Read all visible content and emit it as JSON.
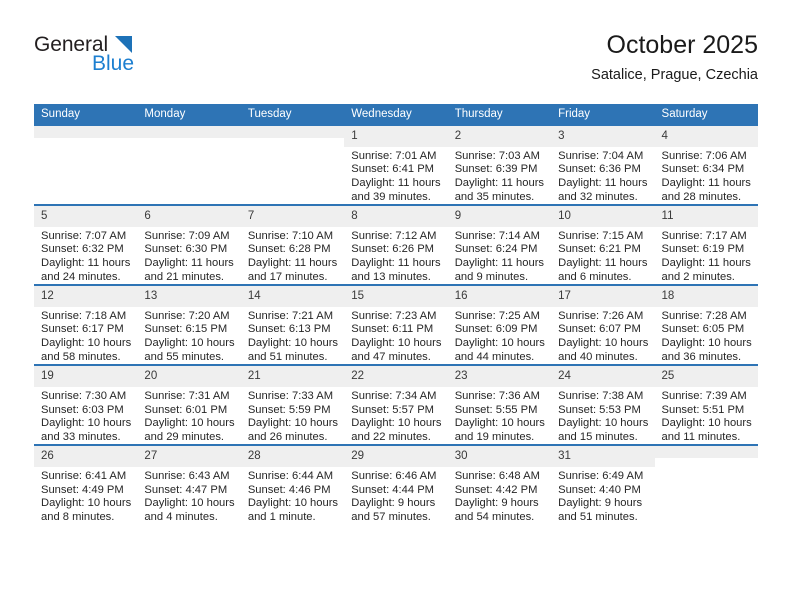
{
  "brand": {
    "name_top": "General",
    "name_bottom": "Blue",
    "triangle_color": "#1d72b8",
    "top_color": "#231f20",
    "bottom_color": "#1d7fd0"
  },
  "header": {
    "month_title": "October 2025",
    "location": "Satalice, Prague, Czechia"
  },
  "theme": {
    "header_blue": "#2e74b5",
    "daynum_band": "#efefef",
    "text": "#262626"
  },
  "weekdays": [
    "Sunday",
    "Monday",
    "Tuesday",
    "Wednesday",
    "Thursday",
    "Friday",
    "Saturday"
  ],
  "weeks": [
    [
      {
        "day": "",
        "blank": true,
        "sunrise": "",
        "sunset": "",
        "daylight1": "",
        "daylight2": ""
      },
      {
        "day": "",
        "blank": true,
        "sunrise": "",
        "sunset": "",
        "daylight1": "",
        "daylight2": ""
      },
      {
        "day": "",
        "blank": true,
        "sunrise": "",
        "sunset": "",
        "daylight1": "",
        "daylight2": ""
      },
      {
        "day": "1",
        "sunrise": "Sunrise: 7:01 AM",
        "sunset": "Sunset: 6:41 PM",
        "daylight1": "Daylight: 11 hours",
        "daylight2": "and 39 minutes."
      },
      {
        "day": "2",
        "sunrise": "Sunrise: 7:03 AM",
        "sunset": "Sunset: 6:39 PM",
        "daylight1": "Daylight: 11 hours",
        "daylight2": "and 35 minutes."
      },
      {
        "day": "3",
        "sunrise": "Sunrise: 7:04 AM",
        "sunset": "Sunset: 6:36 PM",
        "daylight1": "Daylight: 11 hours",
        "daylight2": "and 32 minutes."
      },
      {
        "day": "4",
        "sunrise": "Sunrise: 7:06 AM",
        "sunset": "Sunset: 6:34 PM",
        "daylight1": "Daylight: 11 hours",
        "daylight2": "and 28 minutes."
      }
    ],
    [
      {
        "day": "5",
        "sunrise": "Sunrise: 7:07 AM",
        "sunset": "Sunset: 6:32 PM",
        "daylight1": "Daylight: 11 hours",
        "daylight2": "and 24 minutes."
      },
      {
        "day": "6",
        "sunrise": "Sunrise: 7:09 AM",
        "sunset": "Sunset: 6:30 PM",
        "daylight1": "Daylight: 11 hours",
        "daylight2": "and 21 minutes."
      },
      {
        "day": "7",
        "sunrise": "Sunrise: 7:10 AM",
        "sunset": "Sunset: 6:28 PM",
        "daylight1": "Daylight: 11 hours",
        "daylight2": "and 17 minutes."
      },
      {
        "day": "8",
        "sunrise": "Sunrise: 7:12 AM",
        "sunset": "Sunset: 6:26 PM",
        "daylight1": "Daylight: 11 hours",
        "daylight2": "and 13 minutes."
      },
      {
        "day": "9",
        "sunrise": "Sunrise: 7:14 AM",
        "sunset": "Sunset: 6:24 PM",
        "daylight1": "Daylight: 11 hours",
        "daylight2": "and 9 minutes."
      },
      {
        "day": "10",
        "sunrise": "Sunrise: 7:15 AM",
        "sunset": "Sunset: 6:21 PM",
        "daylight1": "Daylight: 11 hours",
        "daylight2": "and 6 minutes."
      },
      {
        "day": "11",
        "sunrise": "Sunrise: 7:17 AM",
        "sunset": "Sunset: 6:19 PM",
        "daylight1": "Daylight: 11 hours",
        "daylight2": "and 2 minutes."
      }
    ],
    [
      {
        "day": "12",
        "sunrise": "Sunrise: 7:18 AM",
        "sunset": "Sunset: 6:17 PM",
        "daylight1": "Daylight: 10 hours",
        "daylight2": "and 58 minutes."
      },
      {
        "day": "13",
        "sunrise": "Sunrise: 7:20 AM",
        "sunset": "Sunset: 6:15 PM",
        "daylight1": "Daylight: 10 hours",
        "daylight2": "and 55 minutes."
      },
      {
        "day": "14",
        "sunrise": "Sunrise: 7:21 AM",
        "sunset": "Sunset: 6:13 PM",
        "daylight1": "Daylight: 10 hours",
        "daylight2": "and 51 minutes."
      },
      {
        "day": "15",
        "sunrise": "Sunrise: 7:23 AM",
        "sunset": "Sunset: 6:11 PM",
        "daylight1": "Daylight: 10 hours",
        "daylight2": "and 47 minutes."
      },
      {
        "day": "16",
        "sunrise": "Sunrise: 7:25 AM",
        "sunset": "Sunset: 6:09 PM",
        "daylight1": "Daylight: 10 hours",
        "daylight2": "and 44 minutes."
      },
      {
        "day": "17",
        "sunrise": "Sunrise: 7:26 AM",
        "sunset": "Sunset: 6:07 PM",
        "daylight1": "Daylight: 10 hours",
        "daylight2": "and 40 minutes."
      },
      {
        "day": "18",
        "sunrise": "Sunrise: 7:28 AM",
        "sunset": "Sunset: 6:05 PM",
        "daylight1": "Daylight: 10 hours",
        "daylight2": "and 36 minutes."
      }
    ],
    [
      {
        "day": "19",
        "sunrise": "Sunrise: 7:30 AM",
        "sunset": "Sunset: 6:03 PM",
        "daylight1": "Daylight: 10 hours",
        "daylight2": "and 33 minutes."
      },
      {
        "day": "20",
        "sunrise": "Sunrise: 7:31 AM",
        "sunset": "Sunset: 6:01 PM",
        "daylight1": "Daylight: 10 hours",
        "daylight2": "and 29 minutes."
      },
      {
        "day": "21",
        "sunrise": "Sunrise: 7:33 AM",
        "sunset": "Sunset: 5:59 PM",
        "daylight1": "Daylight: 10 hours",
        "daylight2": "and 26 minutes."
      },
      {
        "day": "22",
        "sunrise": "Sunrise: 7:34 AM",
        "sunset": "Sunset: 5:57 PM",
        "daylight1": "Daylight: 10 hours",
        "daylight2": "and 22 minutes."
      },
      {
        "day": "23",
        "sunrise": "Sunrise: 7:36 AM",
        "sunset": "Sunset: 5:55 PM",
        "daylight1": "Daylight: 10 hours",
        "daylight2": "and 19 minutes."
      },
      {
        "day": "24",
        "sunrise": "Sunrise: 7:38 AM",
        "sunset": "Sunset: 5:53 PM",
        "daylight1": "Daylight: 10 hours",
        "daylight2": "and 15 minutes."
      },
      {
        "day": "25",
        "sunrise": "Sunrise: 7:39 AM",
        "sunset": "Sunset: 5:51 PM",
        "daylight1": "Daylight: 10 hours",
        "daylight2": "and 11 minutes."
      }
    ],
    [
      {
        "day": "26",
        "sunrise": "Sunrise: 6:41 AM",
        "sunset": "Sunset: 4:49 PM",
        "daylight1": "Daylight: 10 hours",
        "daylight2": "and 8 minutes."
      },
      {
        "day": "27",
        "sunrise": "Sunrise: 6:43 AM",
        "sunset": "Sunset: 4:47 PM",
        "daylight1": "Daylight: 10 hours",
        "daylight2": "and 4 minutes."
      },
      {
        "day": "28",
        "sunrise": "Sunrise: 6:44 AM",
        "sunset": "Sunset: 4:46 PM",
        "daylight1": "Daylight: 10 hours",
        "daylight2": "and 1 minute."
      },
      {
        "day": "29",
        "sunrise": "Sunrise: 6:46 AM",
        "sunset": "Sunset: 4:44 PM",
        "daylight1": "Daylight: 9 hours",
        "daylight2": "and 57 minutes."
      },
      {
        "day": "30",
        "sunrise": "Sunrise: 6:48 AM",
        "sunset": "Sunset: 4:42 PM",
        "daylight1": "Daylight: 9 hours",
        "daylight2": "and 54 minutes."
      },
      {
        "day": "31",
        "sunrise": "Sunrise: 6:49 AM",
        "sunset": "Sunset: 4:40 PM",
        "daylight1": "Daylight: 9 hours",
        "daylight2": "and 51 minutes."
      },
      {
        "day": "",
        "blank": true,
        "sunrise": "",
        "sunset": "",
        "daylight1": "",
        "daylight2": ""
      }
    ]
  ]
}
